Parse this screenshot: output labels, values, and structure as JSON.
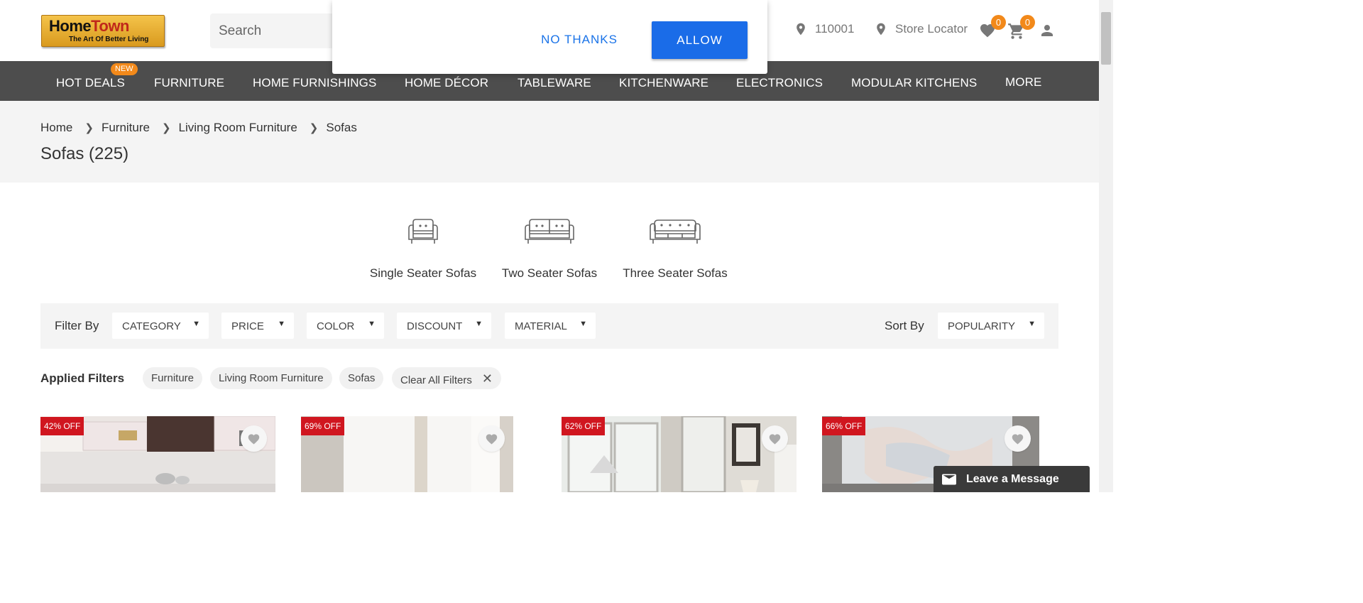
{
  "header": {
    "logo": {
      "word1": "Home",
      "word2": "Town",
      "tagline": "The Art Of Better Living"
    },
    "search": {
      "placeholder": "Search"
    },
    "pincode": "110001",
    "store_locator": "Store Locator",
    "wishlist_count": "0",
    "cart_count": "0"
  },
  "nav": {
    "items": [
      "HOT DEALS",
      "FURNITURE",
      "HOME FURNISHINGS",
      "HOME DÉCOR",
      "TABLEWARE",
      "KITCHENWARE",
      "ELECTRONICS",
      "MODULAR KITCHENS",
      "MORE"
    ],
    "new_badge": "NEW"
  },
  "popup": {
    "deny_label": "NO THANKS",
    "allow_label": "ALLOW"
  },
  "breadcrumb": [
    "Home",
    "Furniture",
    "Living Room Furniture",
    "Sofas"
  ],
  "page_title": "Sofas (225)",
  "categories": [
    {
      "label": "Single Seater Sofas",
      "icon": "single-seater-sofa-icon"
    },
    {
      "label": "Two Seater Sofas",
      "icon": "two-seater-sofa-icon"
    },
    {
      "label": "Three Seater Sofas",
      "icon": "three-seater-sofa-icon"
    }
  ],
  "filters": {
    "label": "Filter By",
    "options": [
      "CATEGORY",
      "PRICE",
      "COLOR",
      "DISCOUNT",
      "MATERIAL"
    ],
    "sort_label": "Sort By",
    "sort_value": "POPULARITY"
  },
  "applied_filters": {
    "label": "Applied Filters",
    "chips": [
      "Furniture",
      "Living Room Furniture",
      "Sofas"
    ],
    "clear_label": "Clear All Filters"
  },
  "products": [
    {
      "discount": "42% OFF"
    },
    {
      "discount": "69% OFF"
    },
    {
      "discount": "62% OFF"
    },
    {
      "discount": "66% OFF"
    }
  ],
  "chat": {
    "label": "Leave a Message"
  },
  "colors": {
    "accent": "#f2891a",
    "nav_bg": "#4d4d4d",
    "allow_btn": "#1a6ce8",
    "discount_tag": "#d0161f"
  }
}
